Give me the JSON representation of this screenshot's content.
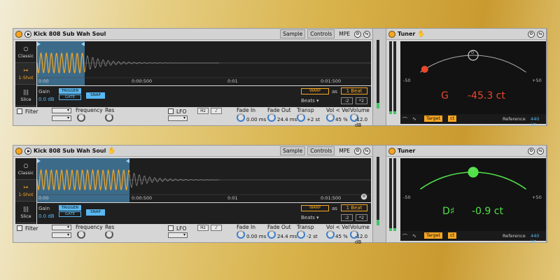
{
  "racks": [
    {
      "simpler": {
        "title": "Kick 808 Sub Wah Soul",
        "tabs": [
          "Sample",
          "Controls",
          "MPE"
        ],
        "modes": [
          {
            "icon": "○",
            "label": "Classic"
          },
          {
            "icon": "↦",
            "label": "1-Shot"
          },
          {
            "icon": "|||",
            "label": "Slice"
          }
        ],
        "timeline": [
          "0:00",
          "0:00:500",
          "0:01",
          "0:01:500"
        ],
        "gain_label": "Gain",
        "gain_value": "0.0 dB",
        "trigger": "TRIGGER",
        "gate": "GATE",
        "snap": "SNAP",
        "warp": "WARP",
        "as": "as",
        "beat": "1 Beat",
        "beats": "Beats",
        "div": ":2",
        "mul": "*2",
        "bottom": {
          "filter": "Filter",
          "frequency": "Frequency",
          "res": "Res",
          "lfo": "LFO",
          "hz": "Hz",
          "note_sym": "♪",
          "fade_in": "Fade In",
          "fade_in_val": "0.00 ms",
          "fade_out": "Fade Out",
          "fade_out_val": "24.4 ms",
          "transp": "Transp",
          "transp_val": "+2 st",
          "vol_vel": "Vol < Vel",
          "vol_vel_val": "45 %",
          "volume": "Volume",
          "volume_val": "-12.0 dB"
        }
      },
      "tuner": {
        "title": "Tuner",
        "zero": "0",
        "minus": "-50",
        "plus": "+50",
        "note": "G",
        "cents": "-45.3 ct",
        "deviation": -45.3,
        "status_color": "#e8472b",
        "target": "Target",
        "ct": "ct",
        "reference_label": "Reference",
        "reference_value": "440 Hz"
      }
    },
    {
      "simpler": {
        "title": "Kick 808 Sub Wah Soul",
        "tabs": [
          "Sample",
          "Controls",
          "MPE"
        ],
        "modes": [
          {
            "icon": "○",
            "label": "Classic"
          },
          {
            "icon": "↦",
            "label": "1-Shot"
          },
          {
            "icon": "|||",
            "label": "Slice"
          }
        ],
        "timeline": [
          "0:00",
          "0:00:500",
          "0:01",
          "0:01:500"
        ],
        "gain_label": "Gain",
        "gain_value": "0.0 dB",
        "trigger": "TRIGGER",
        "gate": "GATE",
        "snap": "SNAP",
        "warp": "WARP",
        "as": "as",
        "beat": "1 Beat",
        "beats": "Beats",
        "div": ":2",
        "mul": "*2",
        "bottom": {
          "filter": "Filter",
          "frequency": "Frequency",
          "res": "Res",
          "lfo": "LFO",
          "hz": "Hz",
          "note_sym": "♪",
          "fade_in": "Fade In",
          "fade_in_val": "0.00 ms",
          "fade_out": "Fade Out",
          "fade_out_val": "24.4 ms",
          "transp": "Transp",
          "transp_val": "-2 st",
          "vol_vel": "Vol < Vel",
          "vol_vel_val": "45 %",
          "volume": "Volume",
          "volume_val": "-12.0 dB"
        }
      },
      "tuner": {
        "title": "Tuner",
        "zero": "0",
        "minus": "-50",
        "plus": "+50",
        "note": "D♯",
        "cents": "-0.9 ct",
        "deviation": -0.9,
        "status_color": "#52e04a",
        "target": "Target",
        "ct": "ct",
        "reference_label": "Reference",
        "reference_value": "440 Hz"
      }
    }
  ]
}
